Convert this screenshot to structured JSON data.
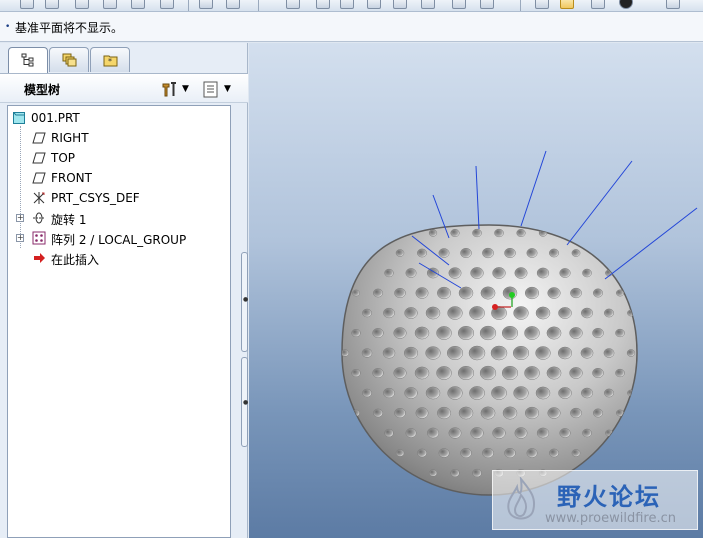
{
  "toolbar": {
    "icons": [
      "new-file-icon",
      "open-file-icon",
      "save-icon",
      "print-icon",
      "send-icon",
      "copy-icon",
      "undo-icon",
      "redo-icon",
      "cut-icon",
      "paste-icon",
      "regenerate-icon",
      "view-manager-icon",
      "plane-display-icon",
      "axis-display-icon",
      "point-display-icon",
      "csys-display-icon",
      "shading-icon",
      "spin-center-icon",
      "appearance-icon",
      "sketch-icon"
    ]
  },
  "message_bar": {
    "bullet": "•",
    "text": "基准平面将不显示。"
  },
  "model_tree": {
    "title": "模型树",
    "tabs": [
      "model-tree-tab",
      "layer-tree-tab",
      "favorites-tab"
    ],
    "header_buttons": [
      "settings-icon",
      "show-icon"
    ],
    "items": [
      {
        "label": "001.PRT",
        "icon": "part-icon",
        "expandable": false
      },
      {
        "label": "RIGHT",
        "icon": "datum-plane-icon",
        "expandable": false
      },
      {
        "label": "TOP",
        "icon": "datum-plane-icon",
        "expandable": false
      },
      {
        "label": "FRONT",
        "icon": "datum-plane-icon",
        "expandable": false
      },
      {
        "label": "PRT_CSYS_DEF",
        "icon": "csys-icon",
        "expandable": false
      },
      {
        "label": "旋转 1",
        "icon": "revolve-icon",
        "expandable": true
      },
      {
        "label": "阵列 2 / LOCAL_GROUP",
        "icon": "pattern-icon",
        "expandable": true
      },
      {
        "label": "在此插入",
        "icon": "insert-here-arrow-icon",
        "expandable": false
      }
    ]
  },
  "watermark": {
    "name": "野火论坛",
    "url": "www.proewildfire.cn"
  }
}
